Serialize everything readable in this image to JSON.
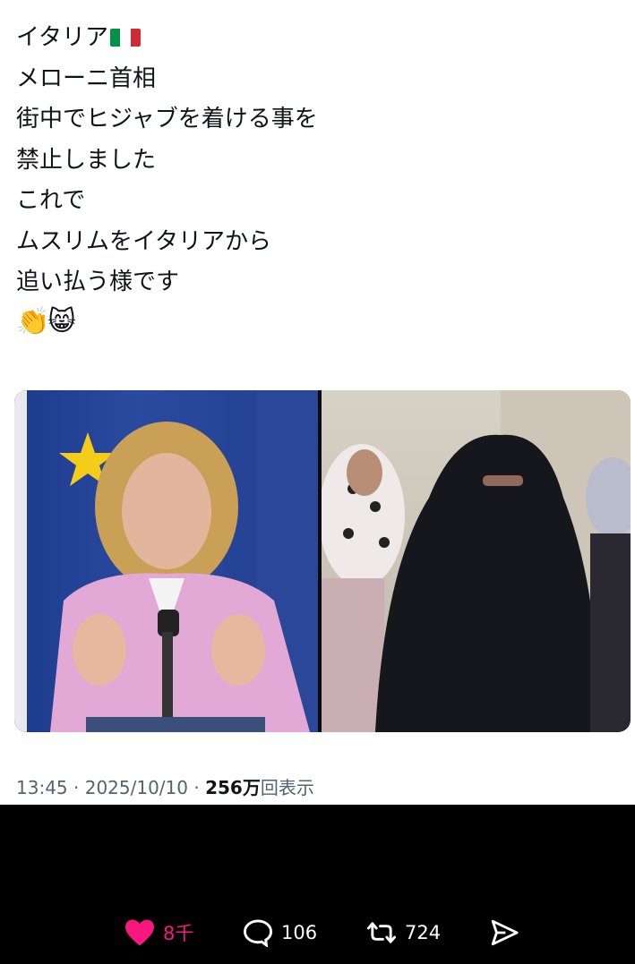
{
  "post": {
    "lines": [
      "イタリア",
      "メローニ首相",
      "街中でヒジャブを着ける事を",
      "禁止しました",
      "これで",
      "ムスリムをイタリアから",
      "追い払う様です"
    ],
    "flag_icon": "italy-flag",
    "flag_colors": [
      "#009246",
      "#ffffff",
      "#ce2b37"
    ],
    "emojis": [
      "👏",
      "😸"
    ]
  },
  "meta": {
    "time": "13:45",
    "date": "2025/10/10",
    "views_count": "256万",
    "views_label": "回表示",
    "separator": "·"
  },
  "actions": {
    "likes": "8千",
    "replies": "106",
    "reposts": "724",
    "like_color": "#f91880"
  }
}
